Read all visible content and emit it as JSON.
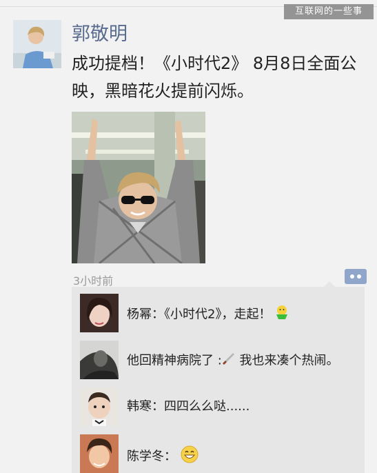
{
  "watermark": "互联网的一些事",
  "post": {
    "author": "郭敬明",
    "text": "成功提档！《小时代2》 8月8日全面公映，黑暗花火提前闪烁。",
    "time": "3小时前"
  },
  "comments": [
    {
      "name": "杨幂",
      "sep": "：",
      "text": "《小时代2》，走起！",
      "emoji": "cheer-emoji"
    },
    {
      "name": "",
      "sep": "",
      "text": "他回精神病院了 :",
      "text2": " 我也来凑个热闹。",
      "emoji": "knife-emoji"
    },
    {
      "name": "韩寒",
      "sep": "：",
      "text": "四四么么哒......",
      "emoji": ""
    },
    {
      "name": "陈学冬",
      "sep": "：",
      "text": "",
      "emoji": "grin-emoji"
    }
  ]
}
